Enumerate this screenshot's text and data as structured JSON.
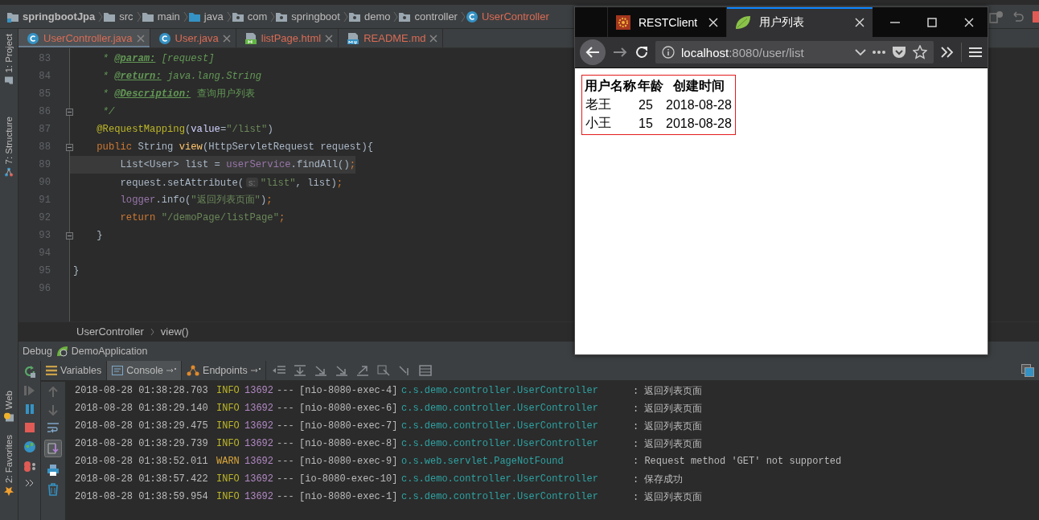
{
  "ide": {
    "breadcrumbs": [
      {
        "label": "springbootJpa",
        "kind": "module"
      },
      {
        "label": "src",
        "kind": "folder"
      },
      {
        "label": "main",
        "kind": "folder"
      },
      {
        "label": "java",
        "kind": "source"
      },
      {
        "label": "com",
        "kind": "package"
      },
      {
        "label": "springboot",
        "kind": "package"
      },
      {
        "label": "demo",
        "kind": "package"
      },
      {
        "label": "controller",
        "kind": "package"
      },
      {
        "label": "UserController",
        "kind": "class"
      }
    ],
    "file_tabs": [
      {
        "label": "UserController.java",
        "kind": "class",
        "selected": true
      },
      {
        "label": "User.java",
        "kind": "class",
        "selected": false
      },
      {
        "label": "listPage.html",
        "kind": "html",
        "selected": false
      },
      {
        "label": "README.md",
        "kind": "md",
        "selected": false
      }
    ],
    "tool_windows": [
      "1: Project",
      "7: Structure",
      "Web",
      "2: Favorites"
    ],
    "editor": {
      "lines": [
        {
          "number": "83",
          "fold_marker": false,
          "current": false,
          "tokens": [
            {
              "kind": "comment",
              "text": "     * "
            },
            {
              "kind": "doctag",
              "text": "@param:"
            },
            {
              "kind": "comment",
              "text": " [request]"
            }
          ]
        },
        {
          "number": "84",
          "fold_marker": false,
          "current": false,
          "tokens": [
            {
              "kind": "comment",
              "text": "     * "
            },
            {
              "kind": "doctag",
              "text": "@return:"
            },
            {
              "kind": "comment",
              "text": " java.lang.String"
            }
          ]
        },
        {
          "number": "85",
          "fold_marker": false,
          "current": false,
          "tokens": [
            {
              "kind": "comment",
              "text": "     * "
            },
            {
              "kind": "doctag",
              "text": "@Description:"
            },
            {
              "kind": "commentcjk",
              "text": " 查询用户列表"
            }
          ]
        },
        {
          "number": "86",
          "fold_marker": true,
          "current": false,
          "tokens": [
            {
              "kind": "comment",
              "text": "     */"
            }
          ]
        },
        {
          "number": "87",
          "fold_marker": false,
          "current": false,
          "tokens": [
            {
              "kind": "annotation",
              "text": "    @RequestMapping"
            },
            {
              "kind": "plain",
              "text": "("
            },
            {
              "kind": "param",
              "text": "value"
            },
            {
              "kind": "plain",
              "text": "="
            },
            {
              "kind": "string",
              "text": "\"/list\""
            },
            {
              "kind": "plain",
              "text": ")"
            }
          ]
        },
        {
          "number": "88",
          "fold_marker": true,
          "current": false,
          "tokens": [
            {
              "kind": "keyword",
              "text": "    public"
            },
            {
              "kind": "plain",
              "text": " String "
            },
            {
              "kind": "method",
              "text": "view"
            },
            {
              "kind": "plain",
              "text": "(HttpServletRequest request){"
            }
          ]
        },
        {
          "number": "89",
          "fold_marker": false,
          "current": true,
          "tokens": [
            {
              "kind": "plain",
              "text": "        List<User> list = "
            },
            {
              "kind": "field",
              "text": "userService"
            },
            {
              "kind": "plain",
              "text": ".findAll()"
            },
            {
              "kind": "keyword",
              "text": ";"
            }
          ]
        },
        {
          "number": "90",
          "fold_marker": false,
          "current": false,
          "tokens": [
            {
              "kind": "plain",
              "text": "        request.setAttribute("
            },
            {
              "kind": "hint",
              "text": "s:"
            },
            {
              "kind": "string",
              "text": "\"list\""
            },
            {
              "kind": "plain",
              "text": ", list)"
            },
            {
              "kind": "keyword",
              "text": ";"
            }
          ]
        },
        {
          "number": "91",
          "fold_marker": false,
          "current": false,
          "tokens": [
            {
              "kind": "field",
              "text": "        logger"
            },
            {
              "kind": "plain",
              "text": ".info("
            },
            {
              "kind": "string",
              "text": "\"返回列表页面\""
            },
            {
              "kind": "plain",
              "text": ")"
            },
            {
              "kind": "keyword",
              "text": ";"
            }
          ]
        },
        {
          "number": "92",
          "fold_marker": false,
          "current": false,
          "tokens": [
            {
              "kind": "keyword",
              "text": "        return"
            },
            {
              "kind": "string",
              "text": " \"/demoPage/listPage\""
            },
            {
              "kind": "keyword",
              "text": ";"
            }
          ]
        },
        {
          "number": "93",
          "fold_marker": true,
          "current": false,
          "tokens": [
            {
              "kind": "plain",
              "text": "    }"
            }
          ]
        },
        {
          "number": "94",
          "fold_marker": false,
          "current": false
        },
        {
          "number": "95",
          "fold_marker": false,
          "current": false,
          "tokens": [
            {
              "kind": "plain",
              "text": "}"
            }
          ]
        },
        {
          "number": "96",
          "fold_marker": false,
          "current": false
        }
      ]
    },
    "editor_breadcrumb": [
      "UserController",
      "view()"
    ],
    "debug": {
      "title": "Debug",
      "configuration": "DemoApplication",
      "tabs": [
        {
          "label": "Variables",
          "selected": false,
          "pinned": false
        },
        {
          "label": "Console",
          "selected": true,
          "pinned": true
        },
        {
          "label": "Endpoints",
          "selected": false,
          "pinned": true
        }
      ],
      "console": [
        {
          "timestamp": "2018-08-28 01:38:28.703",
          "level": "INFO",
          "kind": "info",
          "pid": "13692",
          "separator": "---",
          "thread": "[nio-8080-exec-4]",
          "logger": "c.s.demo.controller.UserController",
          "message": ": 返回列表页面"
        },
        {
          "timestamp": "2018-08-28 01:38:29.140",
          "level": "INFO",
          "kind": "info",
          "pid": "13692",
          "separator": "---",
          "thread": "[nio-8080-exec-6]",
          "logger": "c.s.demo.controller.UserController",
          "message": ": 返回列表页面"
        },
        {
          "timestamp": "2018-08-28 01:38:29.475",
          "level": "INFO",
          "kind": "info",
          "pid": "13692",
          "separator": "---",
          "thread": "[nio-8080-exec-7]",
          "logger": "c.s.demo.controller.UserController",
          "message": ": 返回列表页面"
        },
        {
          "timestamp": "2018-08-28 01:38:29.739",
          "level": "INFO",
          "kind": "info",
          "pid": "13692",
          "separator": "---",
          "thread": "[nio-8080-exec-8]",
          "logger": "c.s.demo.controller.UserController",
          "message": ": 返回列表页面"
        },
        {
          "timestamp": "2018-08-28 01:38:52.011",
          "level": "WARN",
          "kind": "warn",
          "pid": "13692",
          "separator": "---",
          "thread": "[nio-8080-exec-9]",
          "logger": "o.s.web.servlet.PageNotFound",
          "message": ": Request method 'GET' not supported"
        },
        {
          "timestamp": "2018-08-28 01:38:57.422",
          "level": "INFO",
          "kind": "info",
          "pid": "13692",
          "separator": "---",
          "thread": "[io-8080-exec-10]",
          "logger": "c.s.demo.controller.UserController",
          "message": ": 保存成功"
        },
        {
          "timestamp": "2018-08-28 01:38:59.954",
          "level": "INFO",
          "kind": "info",
          "pid": "13692",
          "separator": "---",
          "thread": "[nio-8080-exec-1]",
          "logger": "c.s.demo.controller.UserController",
          "message": ": 返回列表页面"
        }
      ]
    }
  },
  "browser": {
    "tabs": [
      {
        "title": "RESTClient",
        "selected": false
      },
      {
        "title": "用户列表",
        "selected": true
      }
    ],
    "url": {
      "host": "localhost",
      "path": ":8080/user/list"
    },
    "table": {
      "columns": [
        "用户名称",
        "年龄",
        "创建时间"
      ],
      "rows": [
        [
          "老王",
          "25",
          "2018-08-28"
        ],
        [
          "小王",
          "15",
          "2018-08-28"
        ]
      ]
    }
  }
}
